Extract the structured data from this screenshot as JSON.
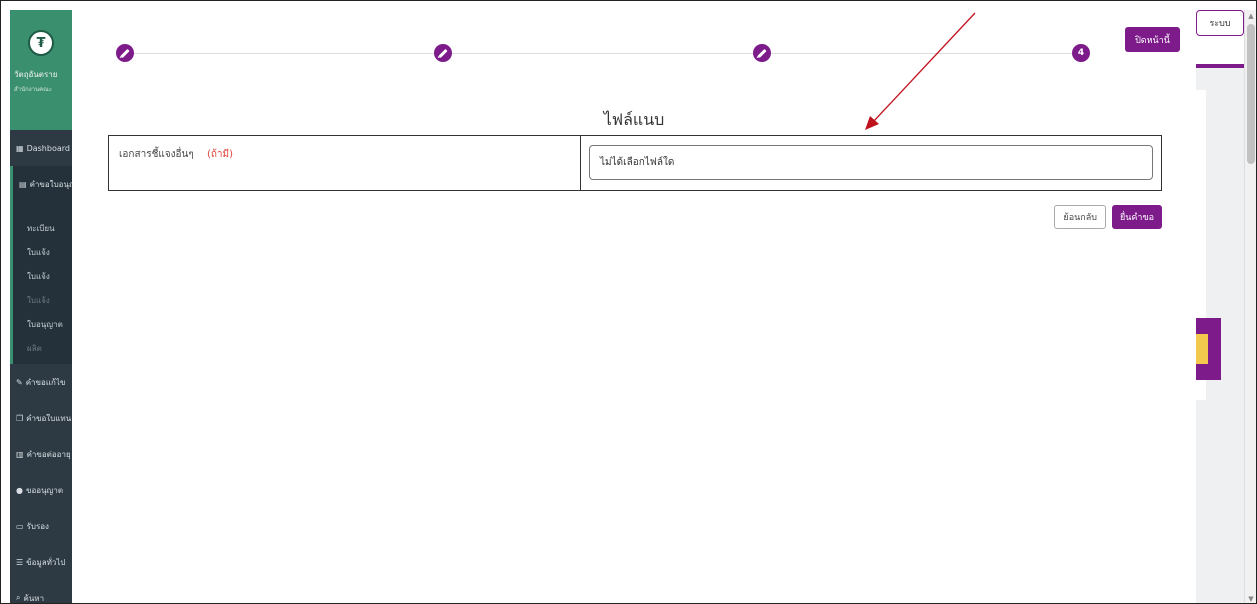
{
  "background_app": {
    "sidebar": {
      "brand_title": "วัตถุอันตราย",
      "brand_subtitle": "สำนักงานคณะ",
      "items": [
        {
          "icon": "grid-icon",
          "label": "Dashboard"
        },
        {
          "icon": "document-icon",
          "label": "คำขอใบอนุญาต"
        }
      ],
      "sub_items": [
        "ทะเบียน",
        "ใบแจ้ง",
        "ใบแจ้ง",
        "ใบแจ้ง",
        "ใบอนุญาต",
        "ผลิต"
      ],
      "more_items": [
        {
          "icon": "edit-icon",
          "label": "คำขอแก้ไข"
        },
        {
          "icon": "copy-icon",
          "label": "คำขอใบแทน"
        },
        {
          "icon": "trash-icon",
          "label": "คำขอต่ออายุ"
        },
        {
          "icon": "circle-icon",
          "label": "ขออนุญาต"
        },
        {
          "icon": "id-card-icon",
          "label": "รับรอง"
        },
        {
          "icon": "list-icon",
          "label": "ข้อมูลทั่วไป"
        },
        {
          "icon": "search-icon",
          "label": "ค้นหา"
        }
      ]
    },
    "top_right_button": "ระบบ"
  },
  "modal": {
    "stepper": {
      "steps": [
        {
          "state": "done",
          "icon": "pencil-icon",
          "label": ""
        },
        {
          "state": "done",
          "icon": "pencil-icon",
          "label": ""
        },
        {
          "state": "done",
          "icon": "pencil-icon",
          "label": ""
        },
        {
          "state": "current",
          "icon": "",
          "label": "4"
        }
      ]
    },
    "close_button": "ปิดหน้านี้",
    "section_title": "ไฟล์แนบ",
    "attachment_row": {
      "label": "เอกสารชี้แจงอื่นๆ",
      "optional": "(ถ้ามี)",
      "file_status": "ไม่ได้เลือกไฟล์ใด"
    },
    "buttons": {
      "back": "ย้อนกลับ",
      "submit": "ยื่นคำขอ"
    }
  },
  "colors": {
    "accent": "#7d1b8a",
    "sidebar_bg": "#2d3a44",
    "brand_green": "#3a8f6f",
    "optional_red": "#e0443a",
    "annotation_arrow": "#c0121e"
  }
}
